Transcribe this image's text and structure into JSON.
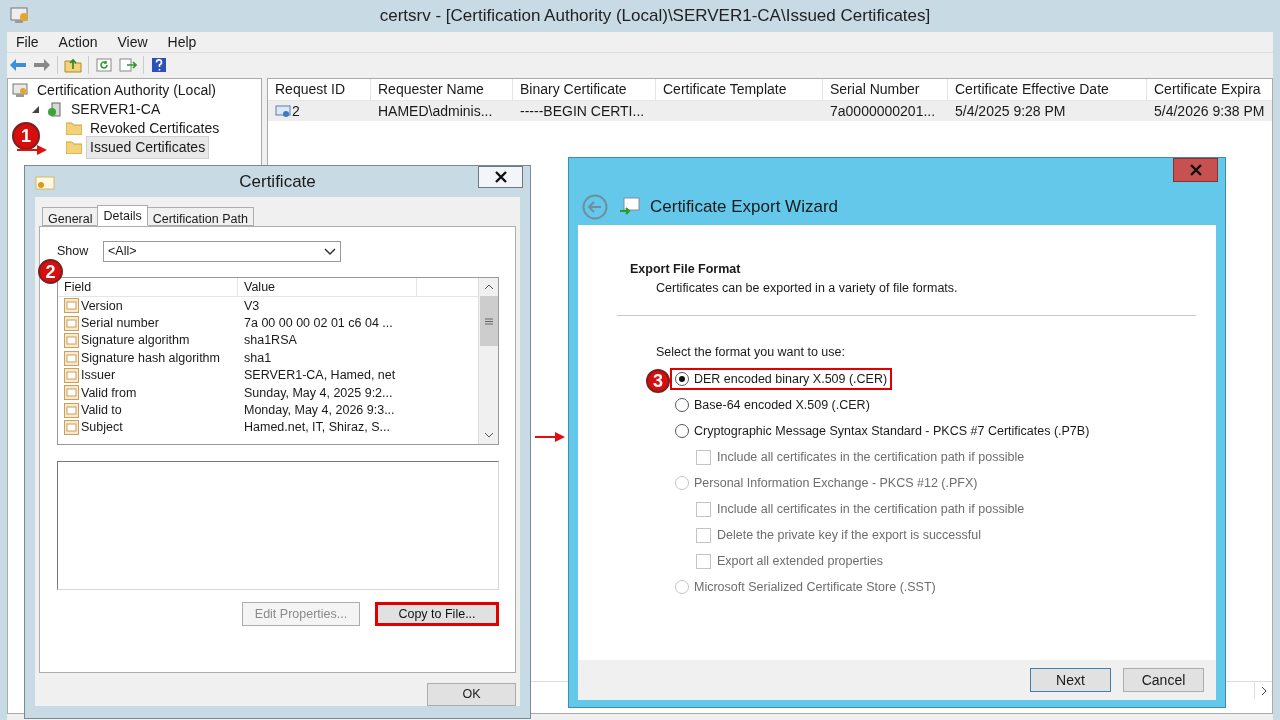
{
  "window": {
    "title": "certsrv - [Certification Authority (Local)\\SERVER1-CA\\Issued Certificates]"
  },
  "menu": [
    "File",
    "Action",
    "View",
    "Help"
  ],
  "tree": {
    "step": "1",
    "items": [
      {
        "label": "Certification Authority (Local)",
        "kind": "root",
        "children": [
          {
            "label": "SERVER1-CA",
            "kind": "server",
            "expanded": true,
            "children": [
              {
                "label": "Revoked Certificates",
                "kind": "folder",
                "selected": false
              },
              {
                "label": "Issued Certificates",
                "kind": "folder",
                "selected": true
              }
            ]
          }
        ]
      }
    ]
  },
  "table": {
    "columns": [
      "Request ID",
      "Requester Name",
      "Binary Certificate",
      "Certificate Template",
      "Serial Number",
      "Certificate Effective Date",
      "Certificate Expira"
    ],
    "rows": [
      {
        "selected": true,
        "cells": [
          "2",
          "HAMED\\adminis...",
          "-----BEGIN CERTI...",
          "",
          "7a0000000201...",
          "5/4/2025 9:28 PM",
          "5/4/2026 9:38 PM"
        ]
      }
    ]
  },
  "certificate": {
    "title": "Certificate",
    "step": "2",
    "tabs": [
      {
        "label": "General",
        "selected": false
      },
      {
        "label": "Details",
        "selected": true
      },
      {
        "label": "Certification Path",
        "selected": false
      }
    ],
    "show_label": "Show",
    "show_value": "<All>",
    "columns": [
      "Field",
      "Value"
    ],
    "fields": [
      {
        "name": "Version",
        "value": "V3"
      },
      {
        "name": "Serial number",
        "value": "7a 00 00 00 02 01 c6 04 ..."
      },
      {
        "name": "Signature algorithm",
        "value": "sha1RSA"
      },
      {
        "name": "Signature hash algorithm",
        "value": "sha1"
      },
      {
        "name": "Issuer",
        "value": "SERVER1-CA, Hamed, net"
      },
      {
        "name": "Valid from",
        "value": "Sunday, May 4, 2025 9:2..."
      },
      {
        "name": "Valid to",
        "value": "Monday, May 4, 2026 9:3..."
      },
      {
        "name": "Subject",
        "value": "Hamed.net, IT, Shiraz, S..."
      }
    ],
    "buttons": [
      {
        "label": "Edit Properties...",
        "disabled": true,
        "highlighted": false
      },
      {
        "label": "Copy to File...",
        "disabled": false,
        "highlighted": true
      }
    ],
    "ok": "OK"
  },
  "wizard": {
    "title": "Certificate Export Wizard",
    "heading": "Export File Format",
    "subheading": "Certificates can be exported in a variety of file formats.",
    "prompt": "Select the format you want to use:",
    "options": [
      {
        "kind": "radio",
        "label": "DER encoded binary X.509 (.CER)",
        "selected": true,
        "disabled": false,
        "highlighted": true,
        "step": "3"
      },
      {
        "kind": "radio",
        "label": "Base-64 encoded X.509 (.CER)",
        "selected": false,
        "disabled": false,
        "highlighted": false
      },
      {
        "kind": "radio",
        "label": "Cryptographic Message Syntax Standard - PKCS #7 Certificates (.P7B)",
        "selected": false,
        "disabled": false,
        "highlighted": false,
        "children": [
          {
            "kind": "checkbox",
            "label": "Include all certificates in the certification path if possible",
            "checked": false,
            "disabled": true
          }
        ]
      },
      {
        "kind": "radio",
        "label": "Personal Information Exchange - PKCS #12 (.PFX)",
        "selected": false,
        "disabled": true,
        "highlighted": false,
        "children": [
          {
            "kind": "checkbox",
            "label": "Include all certificates in the certification path if possible",
            "checked": false,
            "disabled": true
          },
          {
            "kind": "checkbox",
            "label": "Delete the private key if the export is successful",
            "checked": false,
            "disabled": true
          },
          {
            "kind": "checkbox",
            "label": "Export all extended properties",
            "checked": false,
            "disabled": true
          }
        ]
      },
      {
        "kind": "radio",
        "label": "Microsoft Serialized Certificate Store (.SST)",
        "selected": false,
        "disabled": true,
        "highlighted": false
      }
    ],
    "buttons": [
      {
        "label": "Next",
        "default": true
      },
      {
        "label": "Cancel",
        "default": false
      }
    ]
  }
}
